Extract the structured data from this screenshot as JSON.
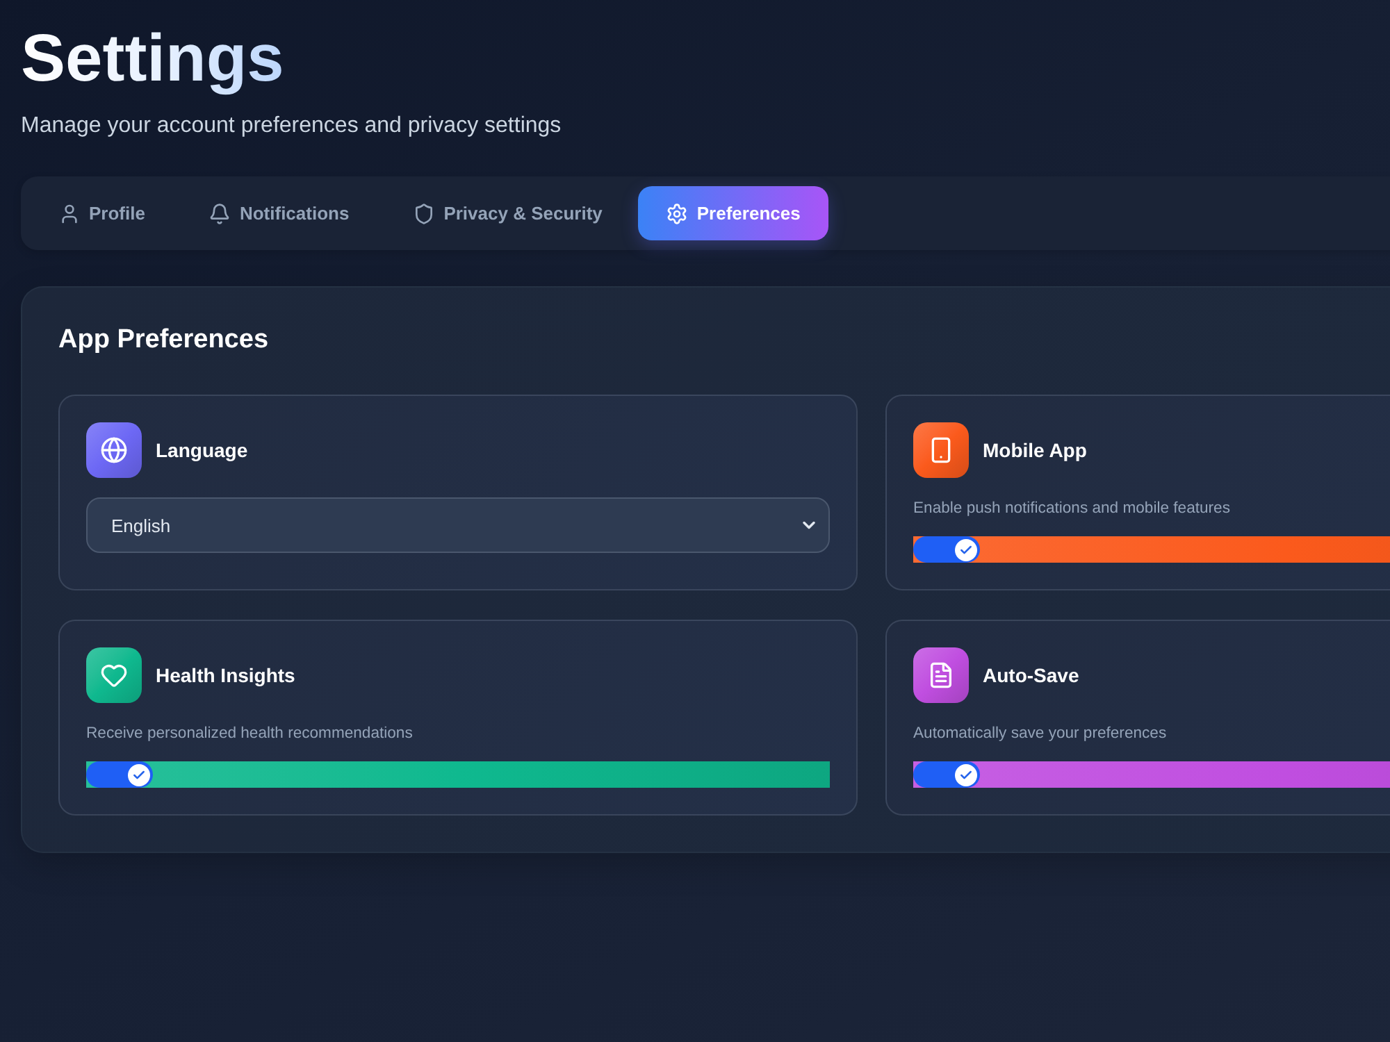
{
  "header": {
    "title": "Settings",
    "subtitle": "Manage your account preferences and privacy settings"
  },
  "tabs": [
    {
      "label": "Profile",
      "selected": false
    },
    {
      "label": "Notifications",
      "selected": false
    },
    {
      "label": "Privacy & Security",
      "selected": false
    },
    {
      "label": "Preferences",
      "selected": true
    }
  ],
  "panel": {
    "title": "App Preferences",
    "items": [
      {
        "kind": "select",
        "title": "Language",
        "color": "#6d68f5",
        "value": "English"
      },
      {
        "kind": "toggle",
        "title": "Mobile App",
        "color": "#fb5a1c",
        "description": "Enable push notifications and mobile features",
        "on": true
      },
      {
        "kind": "toggle",
        "title": "Health Insights",
        "color": "#0fb98f",
        "description": "Receive personalized health recommendations",
        "on": true
      },
      {
        "kind": "toggle",
        "title": "Auto-Save",
        "color": "#c04ee0",
        "description": "Automatically save your preferences",
        "on": true
      }
    ]
  }
}
